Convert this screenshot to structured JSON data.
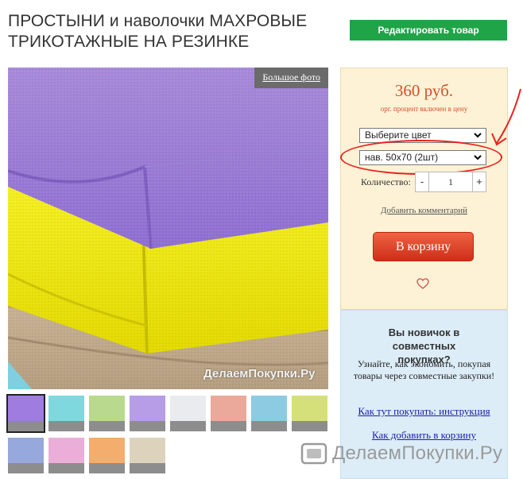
{
  "product": {
    "title_line1": "ПРОСТЫНИ и наволочки МАХРОВЫЕ",
    "title_line2": "ТРИКОТАЖНЫЕ НА РЕЗИНКЕ"
  },
  "toolbar": {
    "edit_label": "Редактировать товар"
  },
  "photo": {
    "big_photo_label": "Большое фото",
    "watermark": "ДелаемПокупки.Ру"
  },
  "thumbnails": [
    {
      "color": "#9e7ce0",
      "active": true
    },
    {
      "color": "#7ed8dd",
      "active": false
    },
    {
      "color": "#b9d98e",
      "active": false
    },
    {
      "color": "#b79ce6",
      "active": false
    },
    {
      "color": "#e9ebef",
      "active": false
    },
    {
      "color": "#eaa99a",
      "active": false
    },
    {
      "color": "#8ccbe1",
      "active": false
    },
    {
      "color": "#d6e07a",
      "active": false
    },
    {
      "color": "#97a9dc",
      "active": false
    },
    {
      "color": "#eaaed9",
      "active": false
    },
    {
      "color": "#f3ad6d",
      "active": false
    },
    {
      "color": "#ddd3bc",
      "active": false
    }
  ],
  "buy": {
    "price": "360 руб.",
    "price_note": "орг. процент включен в цену",
    "color_select": "Выберите цвет",
    "size_select": "нав. 50х70 (2шт)",
    "quantity_label": "Количество:",
    "quantity_value": "1",
    "minus": "-",
    "plus": "+",
    "comment_link": "Добавить комментарий",
    "cart_label": "В корзину"
  },
  "info": {
    "title": "Вы новичок в совместных покупках?",
    "text": "Узнайте, как экономить, покупая товары через совместные закупки!",
    "link1": "Как тут покупать: инструкция",
    "link2": "Как добавить в корзину"
  },
  "site_watermark": "ДелаемПокупки.Ру",
  "colors": {
    "edit_button": "#1fa448",
    "price": "#d34f2a",
    "cart_button": "#e0452a",
    "buybox_bg": "#fdf2d6",
    "infobox_bg": "#dcedf8",
    "annotation": "#e8231c"
  }
}
